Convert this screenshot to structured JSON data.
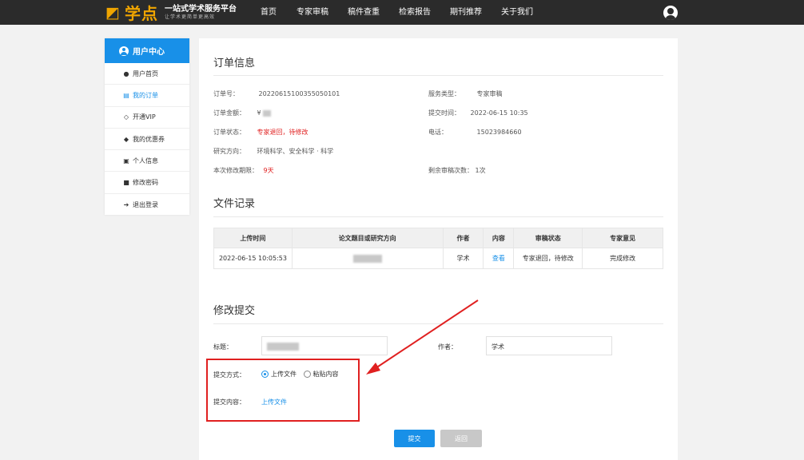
{
  "header": {
    "logo_text": "学点",
    "logo_sub1": "一站式学术服务平台",
    "logo_sub2": "让学术更简单更高效",
    "nav": [
      "首页",
      "专家审稿",
      "稿件查重",
      "检索报告",
      "期刊推荐",
      "关于我们"
    ]
  },
  "sidebar": {
    "title": "用户中心",
    "items": [
      {
        "icon": "user-icon",
        "label": "用户首页"
      },
      {
        "icon": "document-icon",
        "label": "我的订单"
      },
      {
        "icon": "diamond-icon",
        "label": "开通VIP"
      },
      {
        "icon": "tag-icon",
        "label": "我的优惠券"
      },
      {
        "icon": "id-card-icon",
        "label": "个人信息"
      },
      {
        "icon": "lock-icon",
        "label": "修改密码"
      },
      {
        "icon": "logout-icon",
        "label": "退出登录"
      }
    ]
  },
  "order": {
    "title": "订单信息",
    "order_no_label": "订单号：",
    "order_no": "20220615100355050101",
    "service_label": "服务类型：",
    "service": "专家审稿",
    "amount_label": "订单金额：",
    "amount": "¥",
    "time_label": "提交时间：",
    "time": "2022-06-15 10:35",
    "status_label": "订单状态：",
    "status": "专家退回，待修改",
    "phone_label": "电话：",
    "phone": "15023984660",
    "direction_label": "研究方向：",
    "direction": "环境科学、安全科学 · 科学",
    "deadline_label": "本次修改期限：",
    "deadline": "9天",
    "remaining_label": "剩余审稿次数：",
    "remaining": "1次"
  },
  "files": {
    "title": "文件记录",
    "headers": [
      "上传时间",
      "论文题目或研究方向",
      "作者",
      "内容",
      "审稿状态",
      "专家意见"
    ],
    "rows": [
      {
        "time": "2022-06-15 10:05:53",
        "author": "学术",
        "content": "查看",
        "status": "专家退回，待修改",
        "opinion": "完成修改"
      }
    ]
  },
  "revise": {
    "title": "修改提交",
    "title_label": "标题：",
    "author_label": "作者：",
    "author_value": "学术",
    "method_label": "提交方式：",
    "method_options": [
      "上传文件",
      "粘贴内容"
    ],
    "content_label": "提交内容：",
    "upload_link": "上传文件",
    "submit": "提交",
    "back": "返回"
  },
  "colors": {
    "accent": "#1890e8",
    "warning": "#e02020",
    "topbar": "#2b2b2b",
    "logo": "#f0a500"
  }
}
